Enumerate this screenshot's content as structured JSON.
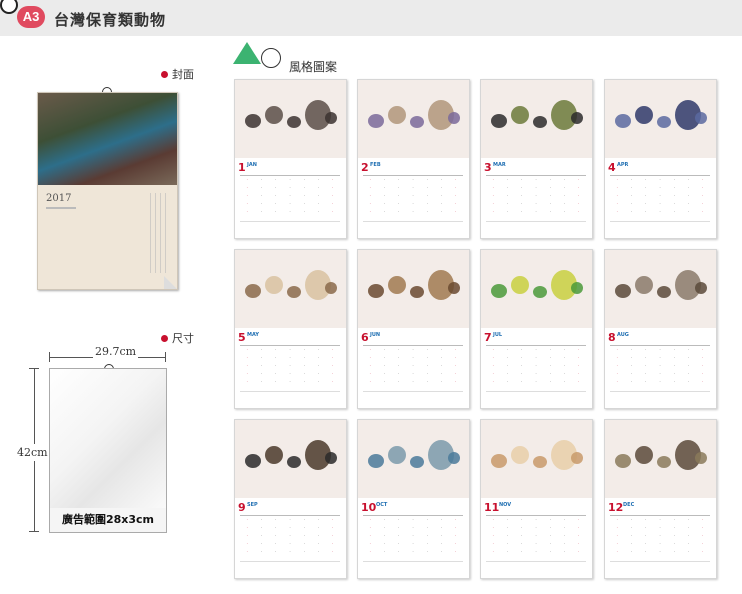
{
  "header": {
    "badge": "A3",
    "title": "台灣保育類動物"
  },
  "labels": {
    "cover": "封面",
    "size": "尺寸",
    "style": "風格圖案",
    "width": "29.7cm",
    "height": "42cm",
    "ad_area": "廣告範圍28x3cm"
  },
  "cover": {
    "year": "2017"
  },
  "months": [
    {
      "num": "1",
      "name": "JAN"
    },
    {
      "num": "2",
      "name": "FEB"
    },
    {
      "num": "3",
      "name": "MAR"
    },
    {
      "num": "4",
      "name": "APR"
    },
    {
      "num": "5",
      "name": "MAY"
    },
    {
      "num": "6",
      "name": "JUN"
    },
    {
      "num": "7",
      "name": "JUL"
    },
    {
      "num": "8",
      "name": "AUG"
    },
    {
      "num": "9",
      "name": "SEP"
    },
    {
      "num": "10",
      "name": "OCT"
    },
    {
      "num": "11",
      "name": "NOV"
    },
    {
      "num": "12",
      "name": "DEC"
    }
  ],
  "colors": {
    "accent": "#e04a5f",
    "month_red": "#c8102e",
    "month_blue": "#1f6fb2"
  }
}
